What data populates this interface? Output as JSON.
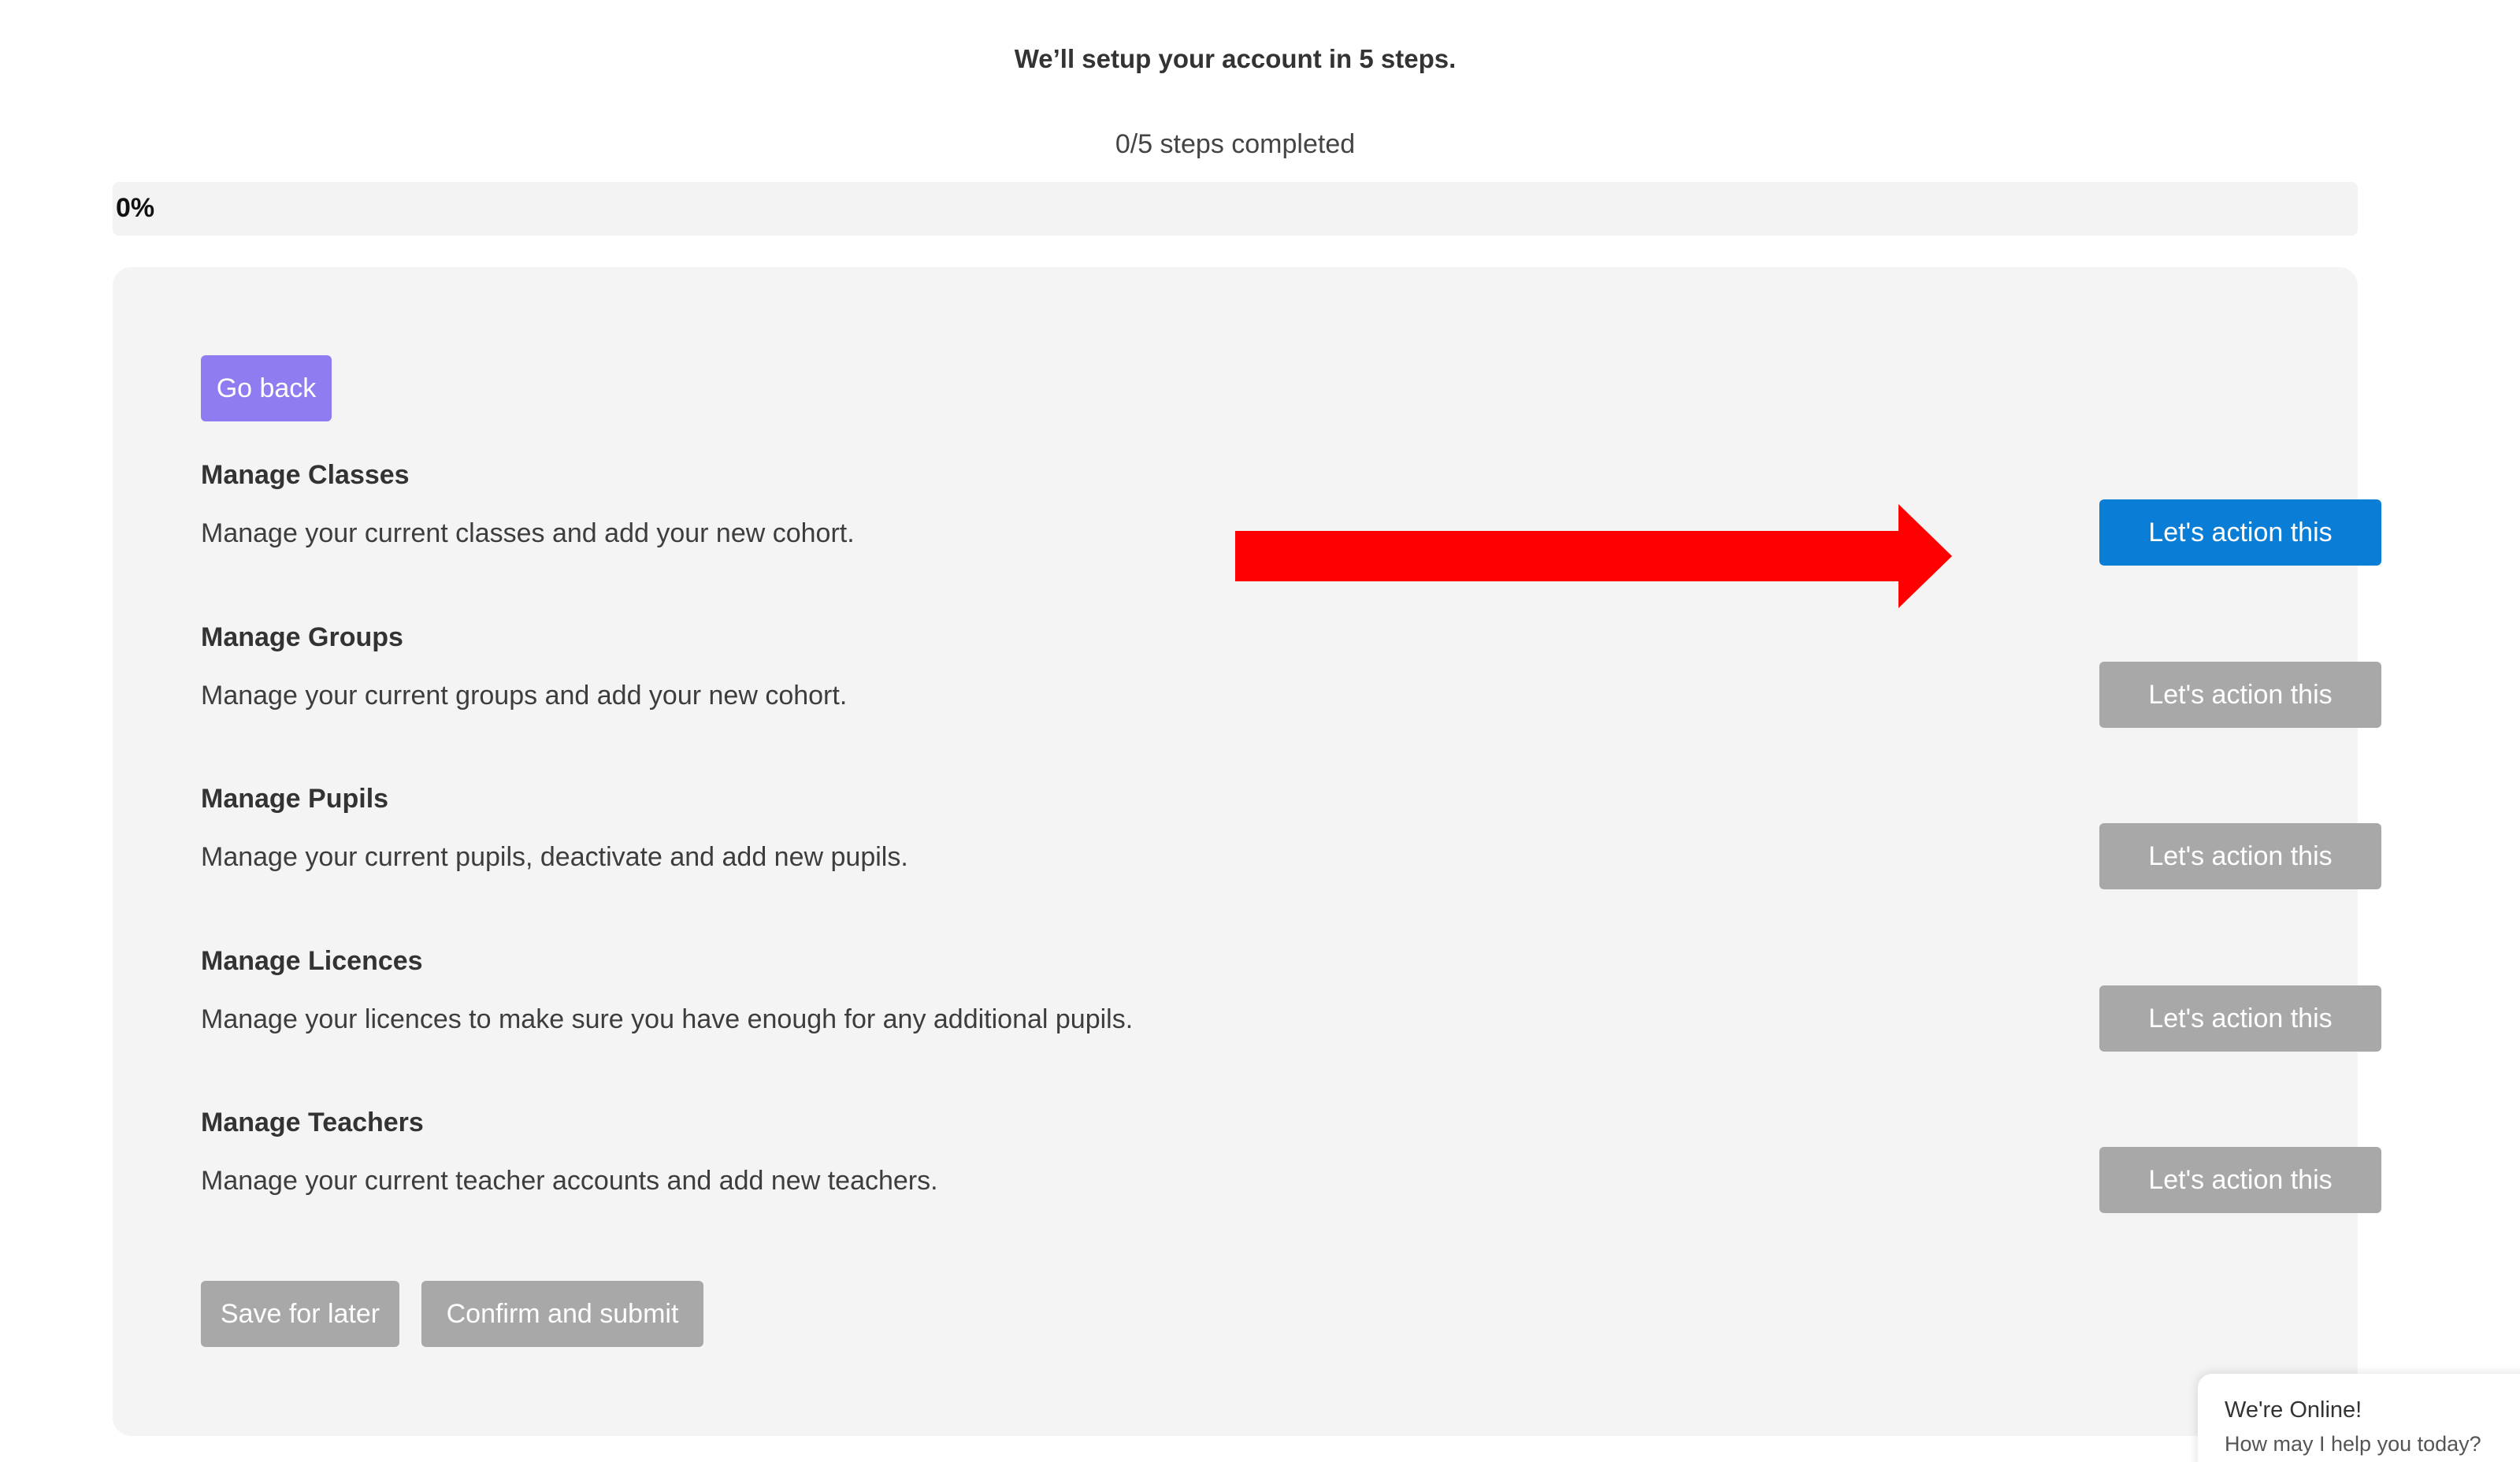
{
  "header": {
    "title": "We’ll setup your account in 5 steps.",
    "steps_completed": "0/5 steps completed"
  },
  "progress": {
    "value": 0,
    "label": "0%"
  },
  "panel": {
    "go_back_label": "Go back",
    "tasks": [
      {
        "title": "Manage Classes",
        "description": "Manage your current classes and add your new cohort.",
        "action_label": "Let's action this",
        "active": true
      },
      {
        "title": "Manage Groups",
        "description": "Manage your current groups and add your new cohort.",
        "action_label": "Let's action this",
        "active": false
      },
      {
        "title": "Manage Pupils",
        "description": "Manage your current pupils, deactivate and add new pupils.",
        "action_label": "Let's action this",
        "active": false
      },
      {
        "title": "Manage Licences",
        "description": "Manage your licences to make sure you have enough for any additional pupils.",
        "action_label": "Let's action this",
        "active": false
      },
      {
        "title": "Manage Teachers",
        "description": "Manage your current teacher accounts and add new teachers.",
        "action_label": "Let's action this",
        "active": false
      }
    ],
    "save_label": "Save for later",
    "confirm_label": "Confirm and submit"
  },
  "chat": {
    "title": "We're Online!",
    "subtitle": "How may I help you today?"
  },
  "colors": {
    "accent_purple": "#8f7cf0",
    "action_blue": "#0a7ed6",
    "disabled_grey": "#a8a8a8",
    "annotation_red": "#ff0000",
    "panel_bg": "#f4f4f4"
  },
  "icons": {
    "annotation": "red-arrow-right"
  }
}
